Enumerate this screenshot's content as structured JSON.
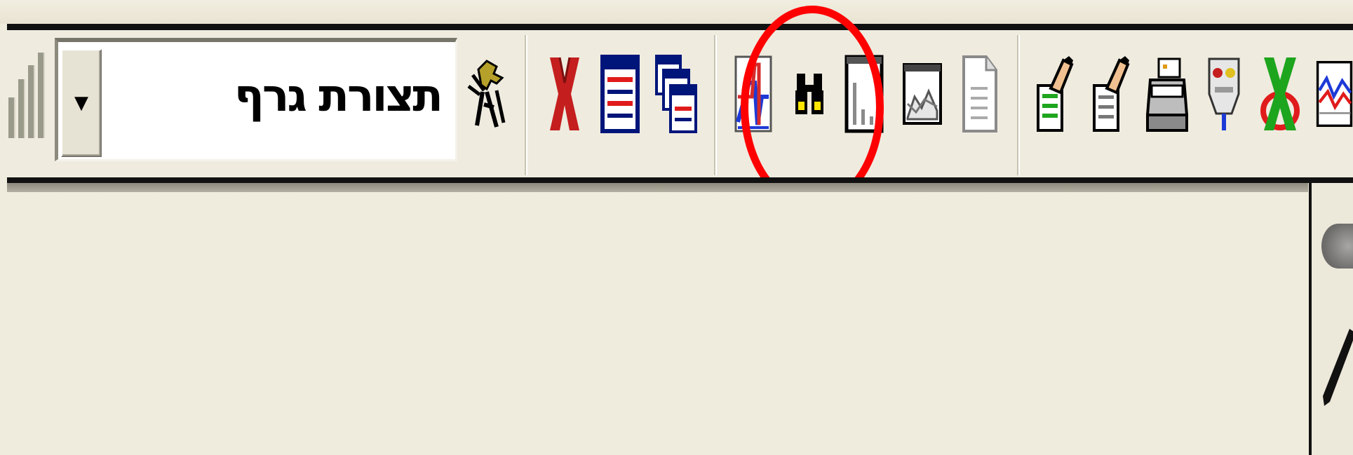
{
  "toolbar": {
    "chart_type_label": "תצורת גרף",
    "chart_type_dropdown_arrow": "▼",
    "icons": [
      "bar-chart-grip-icon",
      "chart-wizard-icon",
      "delete-icon",
      "data-sheet-icon",
      "multiple-sheets-icon",
      "line-chart-icon",
      "binoculars-icon",
      "bar-chart-icon",
      "area-chart-icon",
      "document-icon",
      "edit-green-sheet-icon",
      "edit-sheet-icon",
      "printer-icon",
      "wall-plug-icon",
      "cancel-x-icon",
      "multi-line-chart-icon"
    ]
  },
  "annotation": {
    "highlight_color": "#ff0000"
  },
  "colors": {
    "background": "#efebdd",
    "rule": "#111111",
    "window_face": "#ece9d8"
  }
}
